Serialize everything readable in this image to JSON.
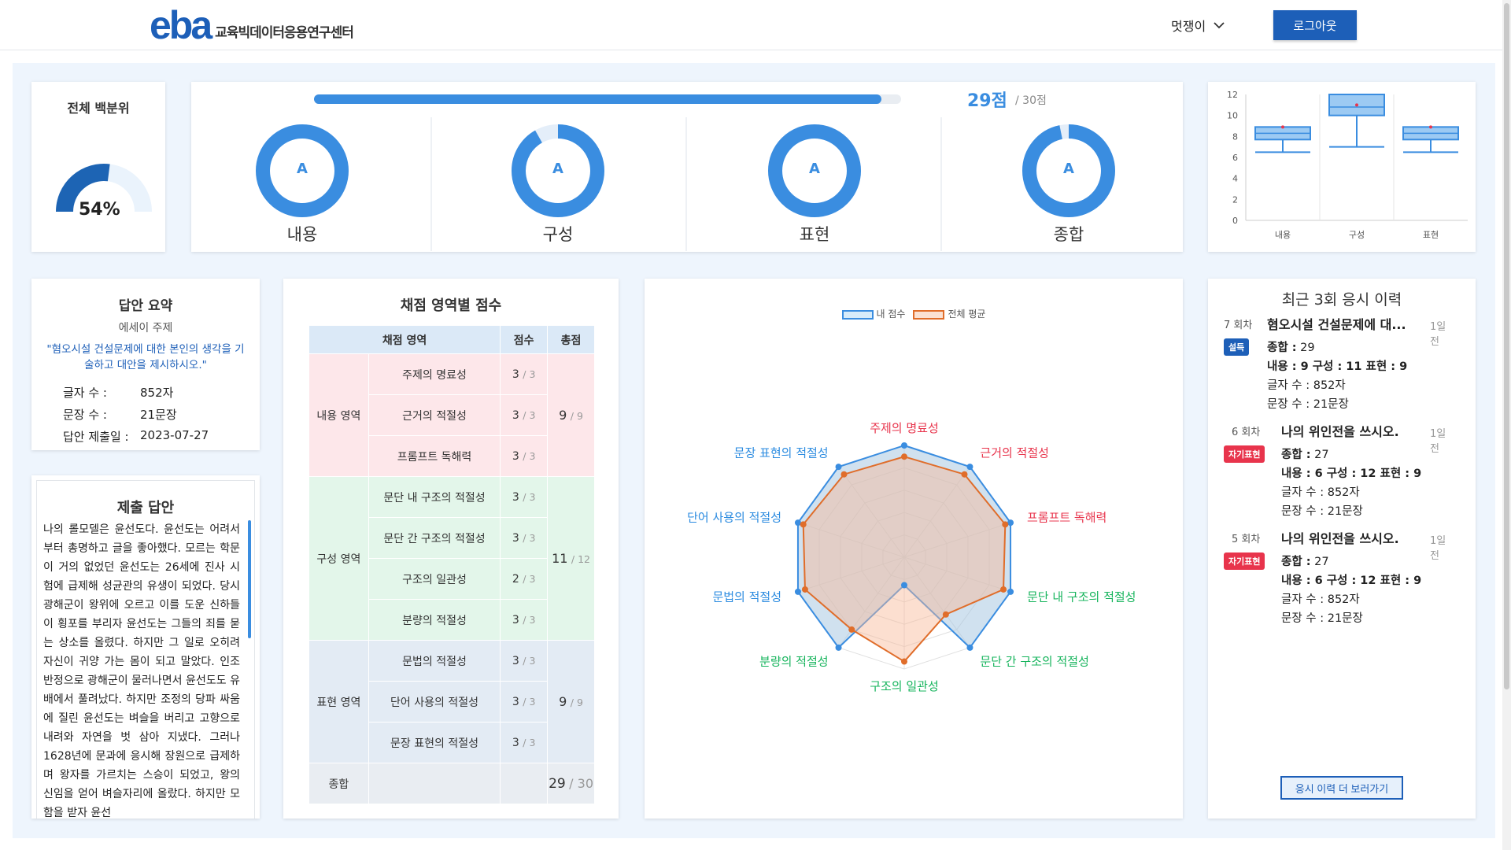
{
  "header": {
    "logo_mark": "eba",
    "logo_text": "교육빅데이터응용연구센터",
    "user_name": "멋쟁이",
    "logout_label": "로그아웃"
  },
  "percentile": {
    "title": "전체 백분위",
    "value_label": "54%",
    "value": 54
  },
  "overall": {
    "score_label": "29점",
    "total_label": "/ 30점",
    "progress": 0.9667,
    "categories": [
      {
        "label": "내용",
        "grade": "A",
        "fraction": 1.0
      },
      {
        "label": "구성",
        "grade": "A",
        "fraction": 0.9167
      },
      {
        "label": "표현",
        "grade": "A",
        "fraction": 1.0
      },
      {
        "label": "종합",
        "grade": "A",
        "fraction": 0.9667
      }
    ]
  },
  "boxplot": {
    "chart_data": {
      "type": "box",
      "categories": [
        "내용",
        "구성",
        "표현"
      ],
      "ylim": [
        0,
        12
      ],
      "yticks": [
        "0",
        "2",
        "4",
        "6",
        "8",
        "10",
        "12"
      ],
      "boxes": [
        {
          "min": 6.5,
          "q1": 7.7,
          "median": 8.3,
          "q3": 8.9,
          "max": 8.9,
          "mean": 8.9
        },
        {
          "min": 7.0,
          "q1": 10.0,
          "median": 10.8,
          "q3": 12.0,
          "max": 12.0,
          "mean": 11.0
        },
        {
          "min": 6.5,
          "q1": 7.7,
          "median": 8.3,
          "q3": 8.9,
          "max": 8.9,
          "mean": 8.9
        }
      ]
    }
  },
  "summary": {
    "title": "답안 요약",
    "subtitle": "에세이 주제",
    "prompt": "\"혐오시설 건설문제에 대한 본인의 생각을 기술하고 대안을 제시하시오.\"",
    "rows": [
      {
        "key": "글자 수 :",
        "value": "852자"
      },
      {
        "key": "문장 수 :",
        "value": "21문장"
      },
      {
        "key": "답안 제출일 :",
        "value": "2023-07-27"
      }
    ]
  },
  "answer": {
    "title": "제출 답안",
    "text": "나의 롤모델은 윤선도다. 윤선도는 어려서부터 총명하고 글을 좋아했다. 모르는 학문이 거의 없었던 윤선도는 26세에 진사 시험에 급제해 성균관의 유생이 되었다. 당시 광해군이 왕위에 오르고 이를 도운 신하들이 횡포를 부리자 윤선도는 그들의 죄를 묻는 상소를 올렸다. 하지만 그 일로 오히려 자신이 귀양 가는 몸이 되고 말았다. 인조 반정으로 광해군이 물러나면서 윤선도도 유배에서 풀려났다. 하지만 조정의 당파 싸움에 질린 윤선도는 벼슬을 버리고 고향으로 내려와 자연을 벗 삼아 지냈다. 그러나 1628년에 문과에 응시해 장원으로 급제하며 왕자를 가르치는 스승이 되었고, 왕의 신임을 얻어 벼슬자리에 올랐다. 하지만 모함을 받자 윤선"
  },
  "score_table": {
    "title": "채점 영역별 점수",
    "headers": [
      "채점 영역",
      "점수",
      "총점"
    ],
    "groups": [
      {
        "name": "내용 영역",
        "total": "9",
        "max": "/ 9",
        "items": [
          {
            "label": "주제의 명료성",
            "score": "3",
            "max": "/ 3"
          },
          {
            "label": "근거의 적절성",
            "score": "3",
            "max": "/ 3"
          },
          {
            "label": "프롬프트 독해력",
            "score": "3",
            "max": "/ 3"
          }
        ]
      },
      {
        "name": "구성 영역",
        "total": "11",
        "max": "/ 12",
        "items": [
          {
            "label": "문단 내 구조의 적절성",
            "score": "3",
            "max": "/ 3"
          },
          {
            "label": "문단 간 구조의 적절성",
            "score": "3",
            "max": "/ 3"
          },
          {
            "label": "구조의 일관성",
            "score": "2",
            "max": "/ 3"
          },
          {
            "label": "분량의 적절성",
            "score": "3",
            "max": "/ 3"
          }
        ]
      },
      {
        "name": "표현 영역",
        "total": "9",
        "max": "/ 9",
        "items": [
          {
            "label": "문법의 적절성",
            "score": "3",
            "max": "/ 3"
          },
          {
            "label": "단어 사용의 적절성",
            "score": "3",
            "max": "/ 3"
          },
          {
            "label": "문장 표현의 적절성",
            "score": "3",
            "max": "/ 3"
          }
        ]
      }
    ],
    "total_label": "종합",
    "total_score": "29",
    "total_max": "/ 30"
  },
  "radar": {
    "chart_data": {
      "type": "radar",
      "axes": [
        "주제의 명료성",
        "근거의 적절성",
        "프롬프트 독해력",
        "문단 내 구조의 적절성",
        "문단 간 구조의 적절성",
        "구조의 일관성",
        "분량의 적절성",
        "문법의 적절성",
        "단어 사용의 적절성",
        "문장 표현의 적절성"
      ],
      "axis_colors": [
        "#e8344c",
        "#e8344c",
        "#e8344c",
        "#16b45c",
        "#16b45c",
        "#16b45c",
        "#16b45c",
        "#2b8be0",
        "#2b8be0",
        "#2b8be0"
      ],
      "max": 3,
      "series": [
        {
          "name": "내 점수",
          "color": "#3a8de0",
          "values": [
            3,
            3,
            3,
            3,
            3,
            0.75,
            3,
            3,
            3,
            3
          ]
        },
        {
          "name": "전체 평균",
          "color": "#e06d2a",
          "values": [
            2.7,
            2.75,
            2.85,
            2.8,
            1.9,
            2.8,
            2.4,
            2.8,
            2.85,
            2.75
          ]
        }
      ]
    }
  },
  "history": {
    "title": "최근 3회 응시 이력",
    "items": [
      {
        "round": "7 회차",
        "question": "혐오시설 건설문제에 대...",
        "ago": "1일 전",
        "badge": "설득",
        "badge_color": "#1d5fb8",
        "total_key": "종합 :",
        "total": "29",
        "parts": "내용 : 9  구성 : 11  표현 : 9",
        "chars": "글자 수 : 852자",
        "sentences": "문장 수 : 21문장"
      },
      {
        "round": "6 회차",
        "question": "나의 위인전을 쓰시오.",
        "ago": "1일 전",
        "badge": "자기표현",
        "badge_color": "#e8344c",
        "total_key": "종합 :",
        "total": "27",
        "parts": "내용 : 6  구성 : 12  표현 : 9",
        "chars": "글자 수 : 852자",
        "sentences": "문장 수 : 21문장"
      },
      {
        "round": "5 회차",
        "question": "나의 위인전을 쓰시오.",
        "ago": "1일 전",
        "badge": "자기표현",
        "badge_color": "#e8344c",
        "total_key": "종합 :",
        "total": "27",
        "parts": "내용 : 6  구성 : 12  표현 : 9",
        "chars": "글자 수 : 852자",
        "sentences": "문장 수 : 21문장"
      }
    ],
    "more_label": "응시 이력 더 보러가기"
  },
  "colors": {
    "accent": "#1d5fb8",
    "light_accent": "#3a8de0",
    "bg": "#eef5fd"
  }
}
